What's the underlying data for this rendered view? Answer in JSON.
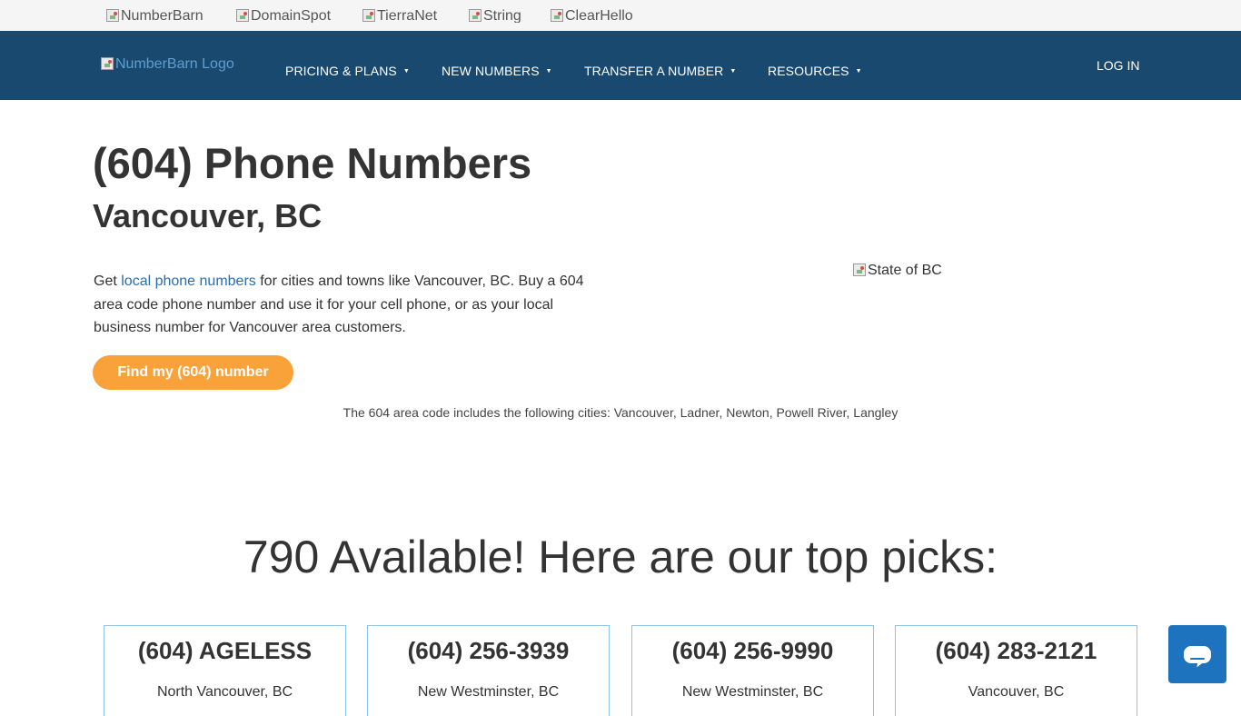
{
  "top_bar": {
    "brands": [
      "NumberBarn",
      "DomainSpot",
      "TierraNet",
      "String",
      "ClearHello"
    ]
  },
  "nav": {
    "logo_alt": "NumberBarn Logo",
    "items": [
      {
        "label": "PRICING & PLANS"
      },
      {
        "label": "NEW NUMBERS"
      },
      {
        "label": "TRANSFER A NUMBER"
      },
      {
        "label": "RESOURCES"
      }
    ],
    "caret": "▼",
    "login": "LOG IN"
  },
  "hero": {
    "title": "(604) Phone Numbers",
    "subtitle": "Vancouver, BC",
    "intro_prefix": "Get ",
    "intro_link": "local phone numbers",
    "intro_suffix": " for cities and towns like Vancouver, BC. Buy a 604 area code phone number and use it for your cell phone, or as your local business number for Vancouver area customers.",
    "state_image_alt": "State of BC",
    "find_button": "Find my (604) number",
    "cities_text": "The 604 area code includes the following cities: Vancouver, Ladner, Newton, Powell River, Langley"
  },
  "picks": {
    "heading": "790 Available! Here are our top picks:",
    "cards": [
      {
        "number": "(604) AGELESS",
        "location": "North Vancouver, BC"
      },
      {
        "number": "(604) 256-3939",
        "location": "New Westminster, BC"
      },
      {
        "number": "(604) 256-9990",
        "location": "New Westminster, BC"
      },
      {
        "number": "(604) 283-2121",
        "location": "Vancouver, BC"
      }
    ]
  },
  "colors": {
    "navbar": "#19496f",
    "accent_button": "#f9a23a",
    "link": "#2a6eb0",
    "chat_button": "#1e73be"
  },
  "icons": {
    "chat": "chat-bubble-icon",
    "broken_image": "broken-image-icon"
  }
}
